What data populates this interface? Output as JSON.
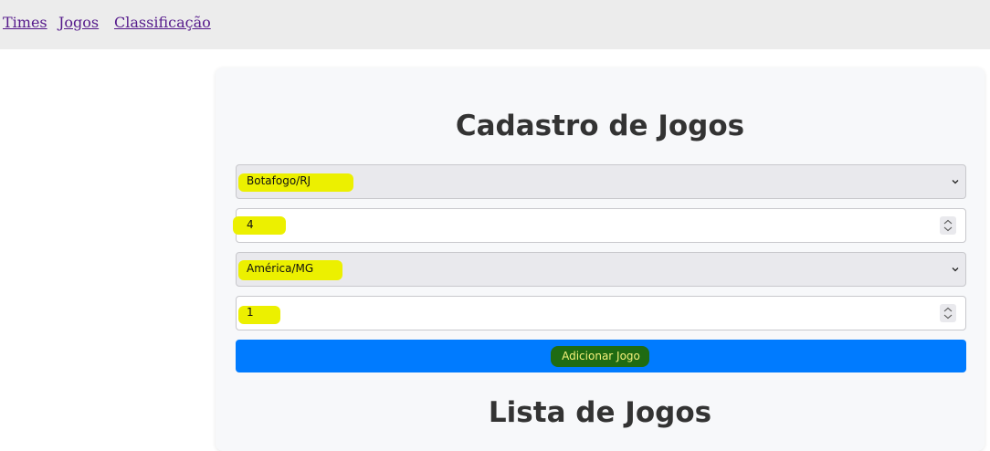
{
  "nav": {
    "links": [
      "Times",
      "Jogos",
      "Classificação"
    ],
    "link_color": "#551a8b"
  },
  "form": {
    "title": "Cadastro de Jogos",
    "home_team": "Botafogo/RJ",
    "home_score": "4",
    "away_team": "América/MG",
    "away_score": "1",
    "submit_label": "Adicionar Jogo"
  },
  "list": {
    "title": "Lista de Jogos"
  },
  "colors": {
    "button": "#007bff",
    "highlight_yellow": "#ecf000",
    "highlight_green": "#1f6b12",
    "nav_bg": "#ececec",
    "card_bg": "#f7f8fa"
  },
  "icons": [
    "chevron-down-icon",
    "spinner-icon"
  ]
}
